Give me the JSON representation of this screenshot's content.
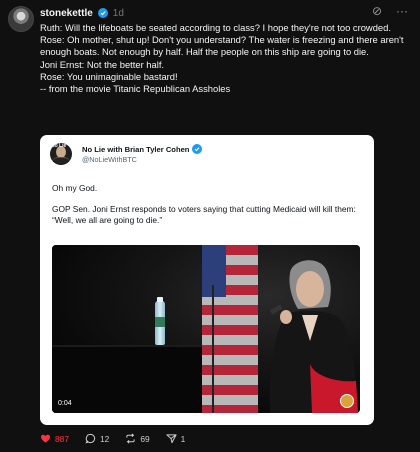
{
  "post": {
    "username": "stonekettle",
    "time": "1d",
    "lines": [
      "Ruth: Will the lifeboats be seated according to class? I hope they're not too crowded.",
      "Rose: Oh mother, shut up! Don't you understand? The water is freezing and there aren't enough boats. Not enough by half. Half the people on this ship are going to die.",
      "Joni Ernst: Not the better half.",
      "Rose: You unimaginable bastard!",
      "-- from the movie Titanic Republican Assholes"
    ]
  },
  "embed": {
    "name": "No Lie with Brian Tyler Cohen",
    "handle": "@NoLieWithBTC",
    "avatar_tag": "No Lie",
    "text1": "Oh my God.",
    "text2": "GOP Sen. Joni Ernst responds to voters saying that cutting Medicaid will kill them: “Well, we all are going to die.”",
    "video_time": "0:04"
  },
  "actions": {
    "likes": "887",
    "replies": "12",
    "reposts": "69",
    "shares": "1"
  },
  "colors": {
    "background": "#101010",
    "like": "#ff3040",
    "verified": "#1d9bf0"
  }
}
